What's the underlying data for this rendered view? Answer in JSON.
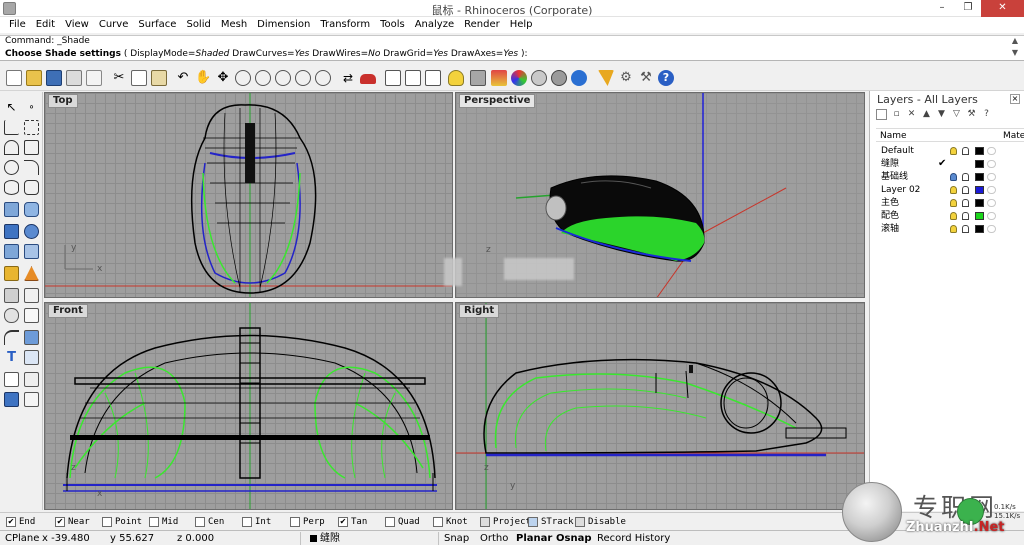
{
  "window": {
    "title": "鼠标 - Rhinoceros (Corporate)",
    "controls": [
      "–",
      "❐",
      "✕"
    ]
  },
  "menu": [
    "File",
    "Edit",
    "View",
    "Curve",
    "Surface",
    "Solid",
    "Mesh",
    "Dimension",
    "Transform",
    "Tools",
    "Analyze",
    "Render",
    "Help"
  ],
  "command": {
    "history": "Command: _Shade",
    "prompt_label": "Choose Shade settings",
    "options_open": "( ",
    "opt1_key": "DisplayMode=",
    "opt1_val": "Shaded",
    "opt2_key": "DrawCurves=",
    "opt2_val": "Yes",
    "opt3_key": "DrawWires=",
    "opt3_val": "No",
    "opt4_key": "DrawGrid=",
    "opt4_val": "Yes",
    "opt5_key": "DrawAxes=",
    "opt5_val": "Yes",
    "options_close": " ):"
  },
  "viewports": {
    "top": "Top",
    "perspective": "Perspective",
    "front": "Front",
    "right": "Right"
  },
  "axis_labels": {
    "top_y": "y",
    "top_x": "x",
    "persp_z": "z",
    "front_z": "z",
    "front_x": "x",
    "right_z": "z",
    "right_y": "y"
  },
  "layers": {
    "title": "Layers - All Layers",
    "col_name": "Name",
    "col_material": "Mater",
    "rows": [
      {
        "name": "Default",
        "current": false,
        "color": "#000000"
      },
      {
        "name": "缝隙",
        "current": true,
        "color": "#000000"
      },
      {
        "name": "基础线",
        "current": false,
        "color": "#000000"
      },
      {
        "name": "Layer 02",
        "current": false,
        "color": "#1b1bd6"
      },
      {
        "name": "主色",
        "current": false,
        "color": "#000000"
      },
      {
        "name": "配色",
        "current": false,
        "color": "#1bd61b"
      },
      {
        "name": "滚轴",
        "current": false,
        "color": "#000000"
      }
    ],
    "current_mark": "✔"
  },
  "osnaps": [
    {
      "label": "End",
      "checked": true
    },
    {
      "label": "Near",
      "checked": true
    },
    {
      "label": "Point",
      "checked": false
    },
    {
      "label": "Mid",
      "checked": false
    },
    {
      "label": "Cen",
      "checked": false
    },
    {
      "label": "Int",
      "checked": false
    },
    {
      "label": "Perp",
      "checked": false
    },
    {
      "label": "Tan",
      "checked": true
    },
    {
      "label": "Quad",
      "checked": false
    },
    {
      "label": "Knot",
      "checked": false
    },
    {
      "label": "Project",
      "checked": false
    },
    {
      "label": "STrack",
      "checked": false
    },
    {
      "label": "Disable",
      "checked": false
    }
  ],
  "status": {
    "cplane": "CPlane",
    "x": "x -39.480",
    "y": "y 55.627",
    "z": "z 0.000",
    "layer": "缝隙",
    "snap": "Snap",
    "ortho": "Ortho",
    "planar": "Planar",
    "osnap": "Osnap",
    "record": "Record History"
  },
  "watermark": {
    "cn": "专职网",
    "url_prefix": "ZhuanzhI",
    "url_dot": ".",
    "url_suffix": "Net",
    "speed1": "0.1K/s",
    "speed2": "15.1K/s"
  },
  "colors": {
    "wire_green": "#39e82e",
    "wire_blue": "#2323c8",
    "axis_red": "#c8352a",
    "axis_green": "#25a32d",
    "axis_blue": "#2020d8",
    "viewport_bg": "#9e9e9e"
  },
  "icons": {
    "toolbar": [
      "new-file-icon",
      "open-folder-icon",
      "save-icon",
      "print-icon",
      "import-icon",
      "cut-icon",
      "copy-icon",
      "paste-icon",
      "undo-icon",
      "pan-hand-icon",
      "rotate-view-icon",
      "zoom-window-icon",
      "zoom-icon",
      "zoom-extents-icon",
      "zoom-selected-icon",
      "select-icon",
      "car-icon",
      "fourview-icon",
      "wireframe-icon",
      "shaded-icon",
      "rendered-icon",
      "light-icon",
      "layer-icon",
      "properties-icon",
      "materials-icon",
      "environment-icon",
      "sphere-icon",
      "sun-icon",
      "options-icon",
      "tools-icon",
      "help-icon"
    ],
    "left": [
      "select-arrow-icon",
      "point-icon",
      "polyline-icon",
      "curve-point-icon",
      "arc-icon",
      "rectangle-icon",
      "circle-icon",
      "fillet-icon",
      "ellipse-icon",
      "offset-icon",
      "surface-icon",
      "loft-icon",
      "box-icon",
      "sphere-solid-icon",
      "extrude-icon",
      "blend-icon",
      "move-icon",
      "transform-icon",
      "boolean-icon",
      "mirror-icon",
      "group-icon",
      "dimension-icon",
      "text-icon",
      "analyze-icon",
      "grid-icon",
      "render-icon",
      "mesh-icon",
      "layout-icon"
    ]
  }
}
